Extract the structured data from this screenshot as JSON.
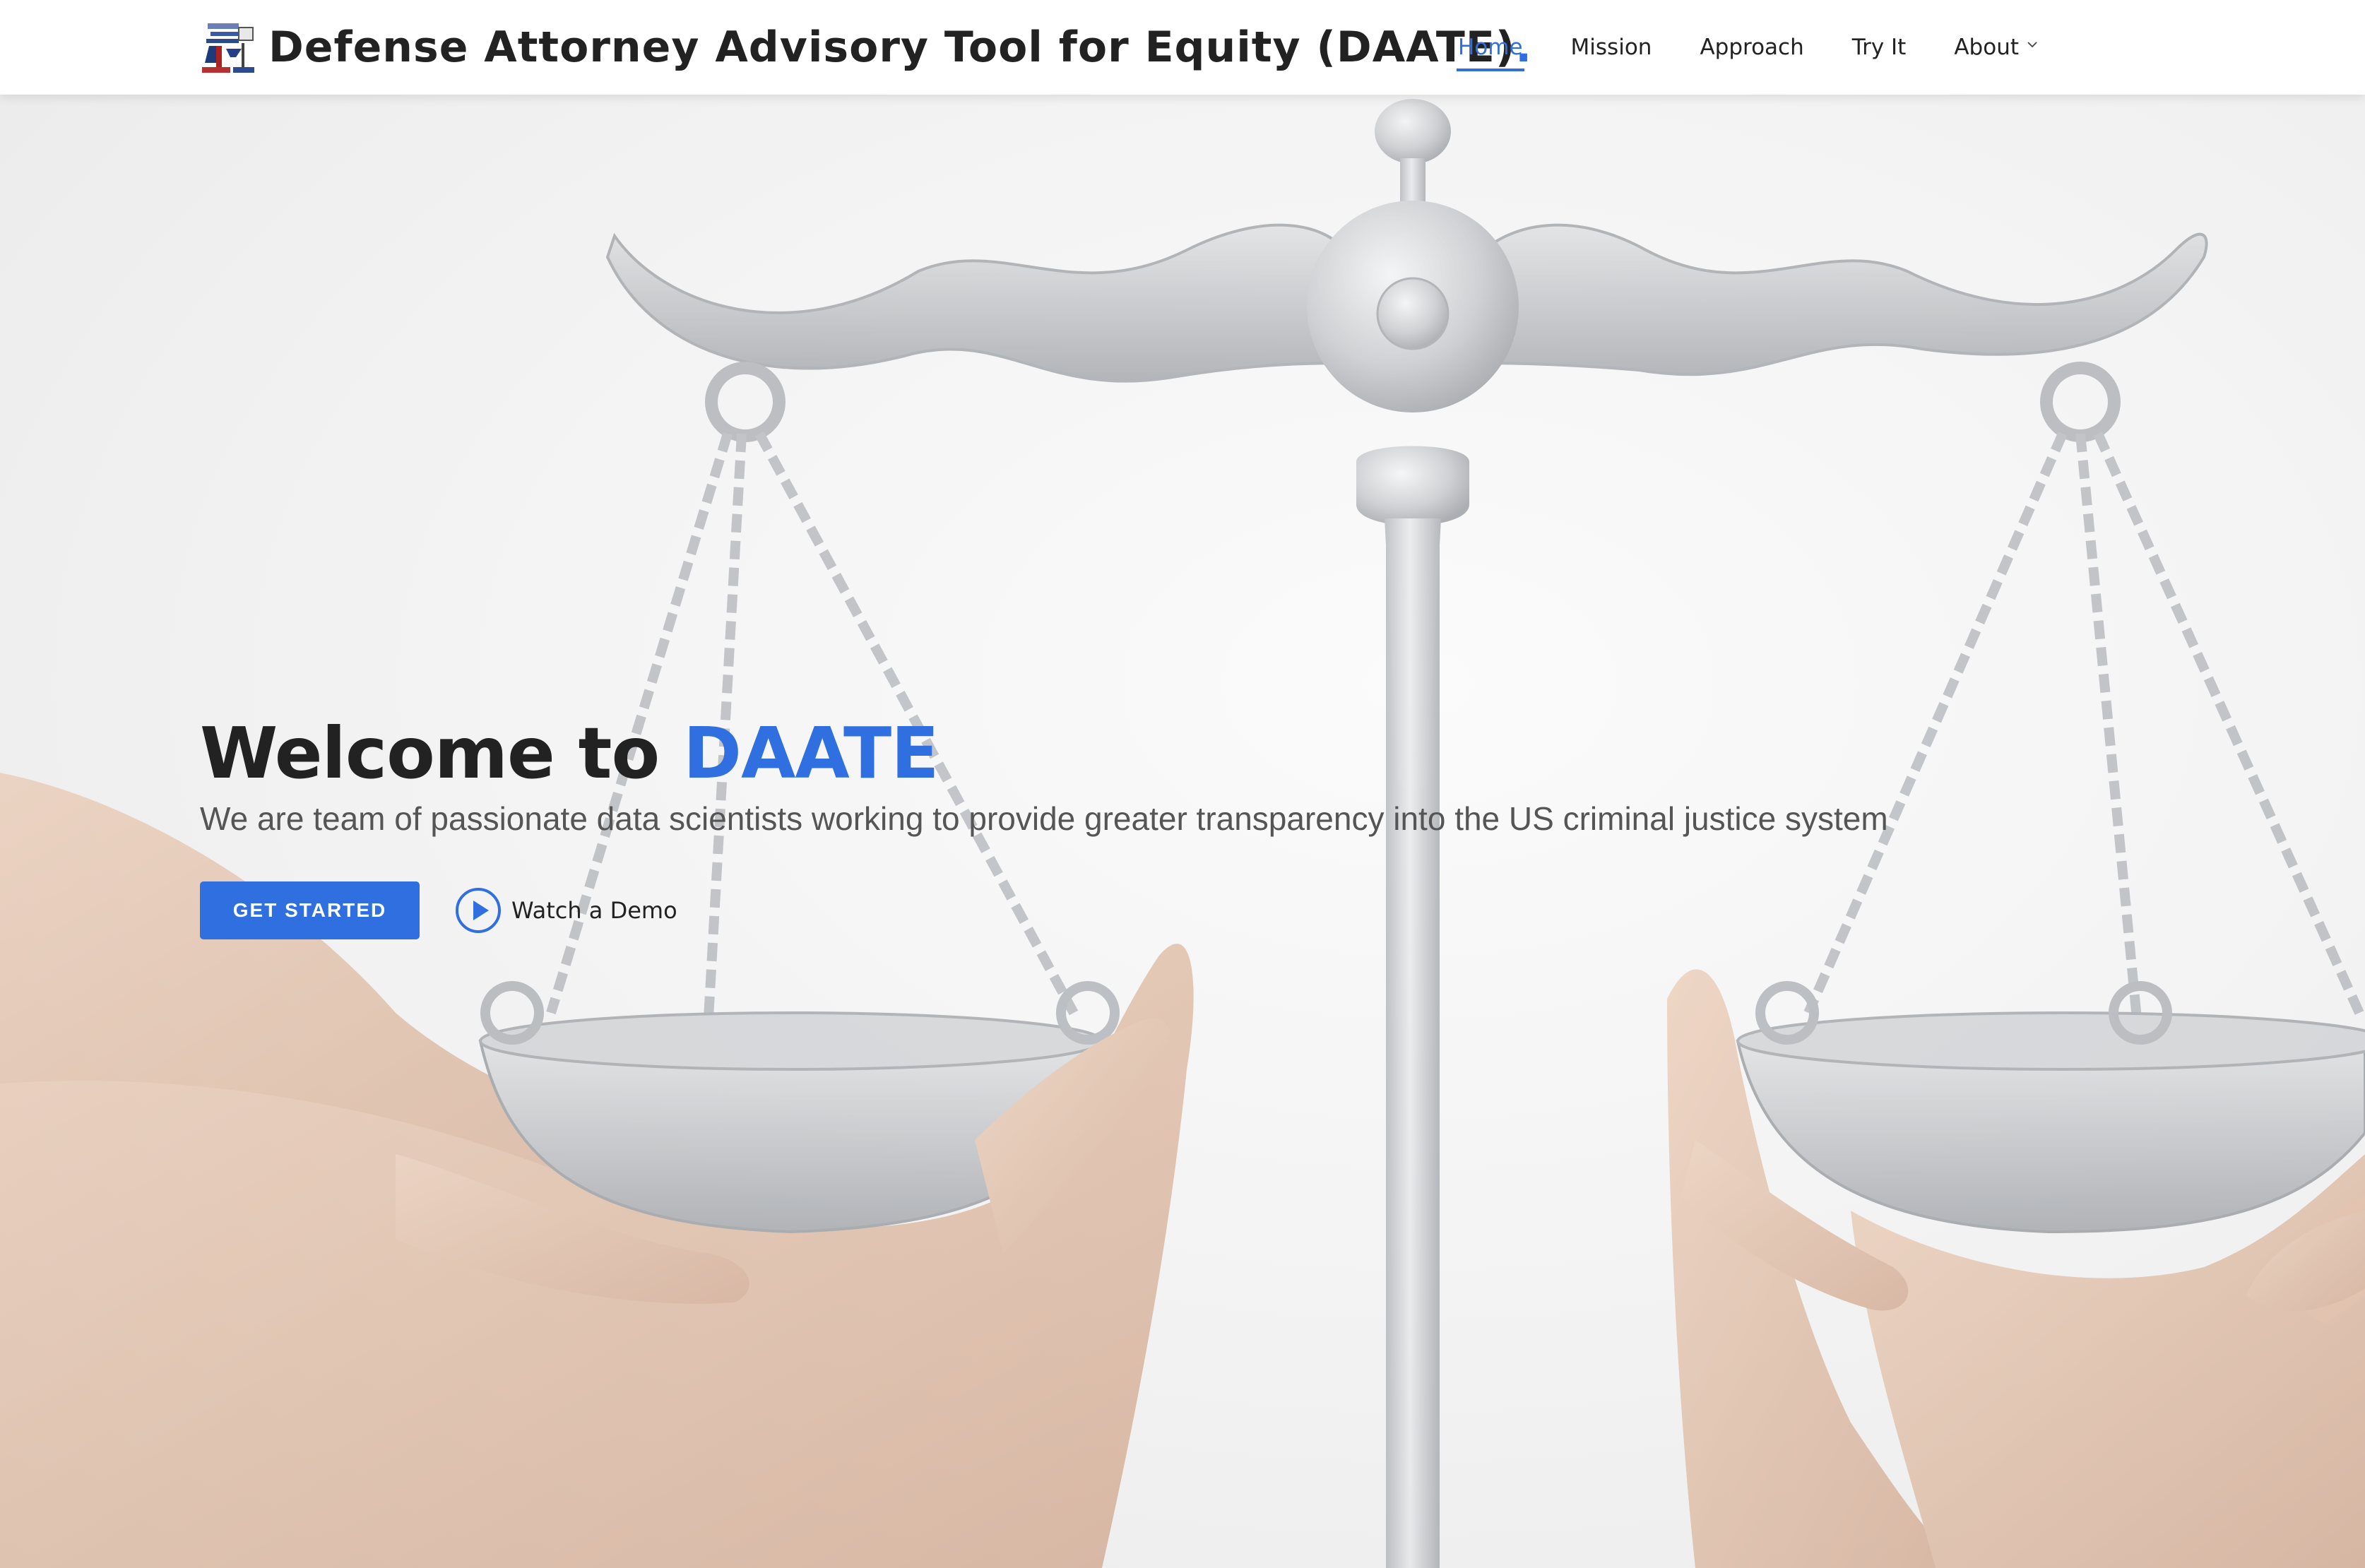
{
  "header": {
    "title": "Defense Attorney Advisory Tool for Equity (DAATE)",
    "title_dot": ".",
    "logo_icon": "scales-of-justice-logo",
    "nav": [
      {
        "label": "Home",
        "active": true
      },
      {
        "label": "Mission",
        "active": false
      },
      {
        "label": "Approach",
        "active": false
      },
      {
        "label": "Try It",
        "active": false
      },
      {
        "label": "About",
        "active": false,
        "has_dropdown": true
      }
    ]
  },
  "hero": {
    "title_prefix": "Welcome to ",
    "title_accent": "DAATE",
    "subtitle": "We are team of passionate data scientists working to provide greater transparency into the US criminal justice system",
    "get_started_label": "GET STARTED",
    "demo_label": "Watch a Demo",
    "demo_icon": "play-circle-icon",
    "background": "scales-of-justice-held-by-hands"
  },
  "colors": {
    "accent": "#2f6fe0",
    "text": "#222222",
    "subtext": "#555555",
    "header_bg": "#ffffff"
  }
}
